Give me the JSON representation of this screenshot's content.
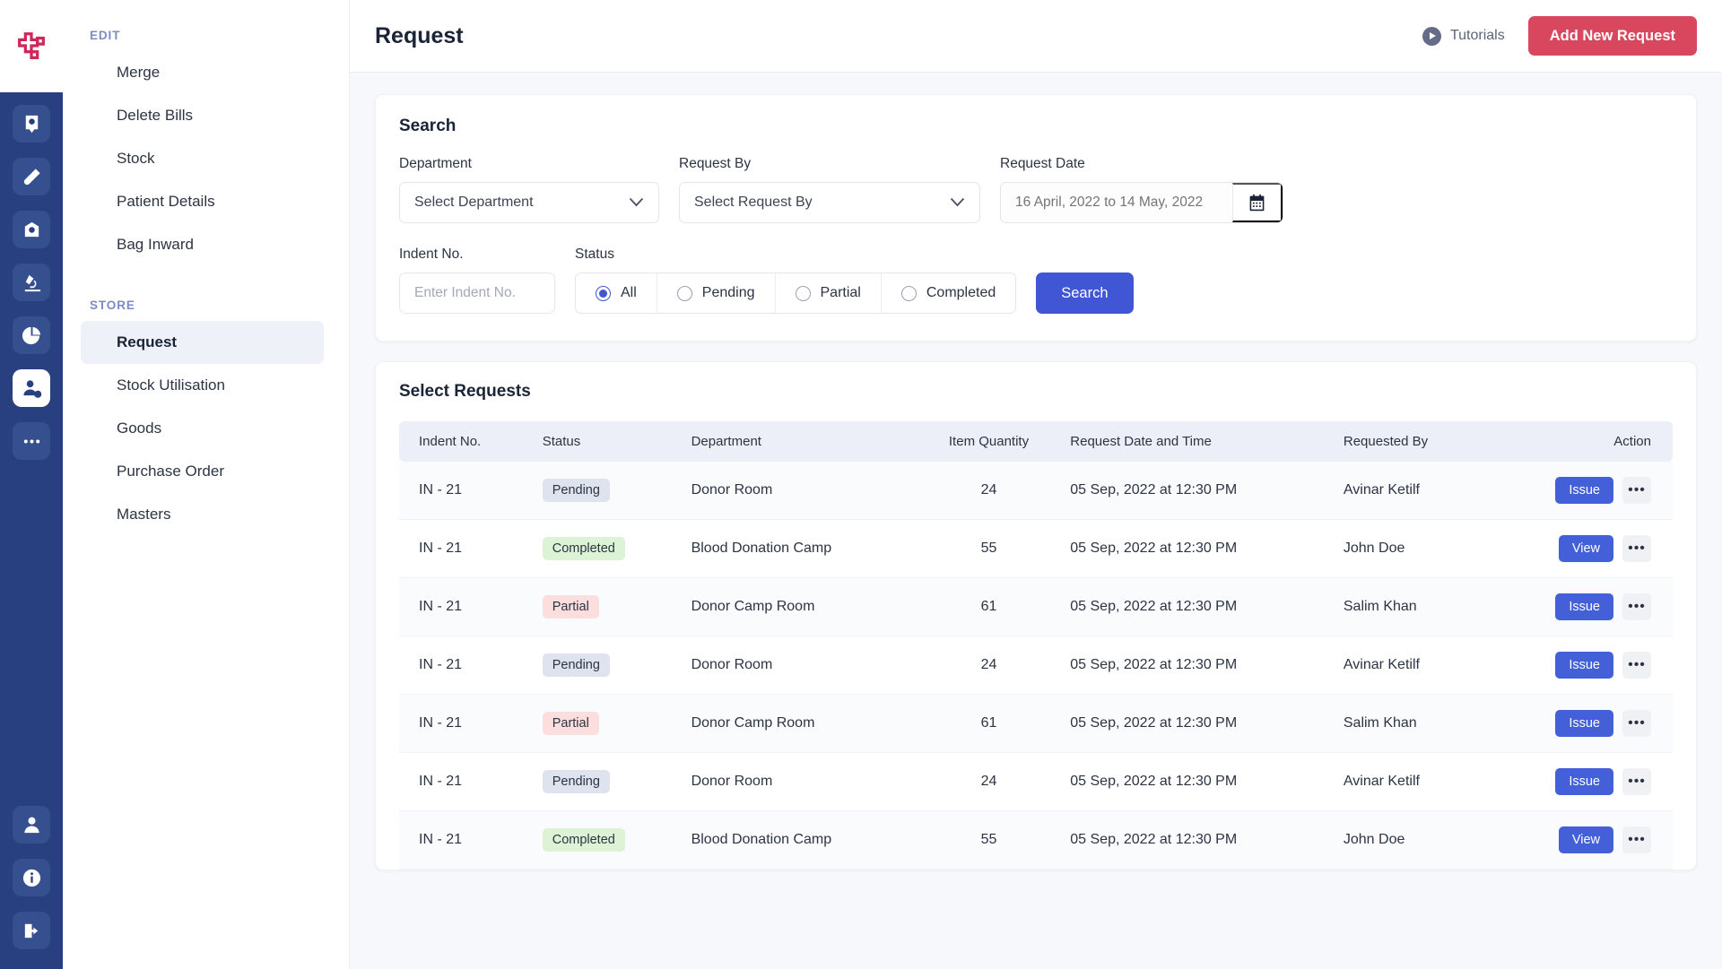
{
  "brand": {
    "logo_icon": "medical-cross-logo",
    "accent_red": "#d9475f",
    "accent_blue": "#4056d4",
    "rail_bg": "#28407f"
  },
  "rail": {
    "items": [
      {
        "icon": "blood-bag-icon",
        "active": false
      },
      {
        "icon": "test-tube-icon",
        "active": false
      },
      {
        "icon": "centrifuge-icon",
        "active": false
      },
      {
        "icon": "microscope-icon",
        "active": false
      },
      {
        "icon": "pie-chart-icon",
        "active": false
      },
      {
        "icon": "user-settings-icon",
        "active": true
      },
      {
        "icon": "more-dots-icon",
        "active": false
      }
    ],
    "bottom_items": [
      {
        "icon": "user-icon"
      },
      {
        "icon": "info-icon"
      },
      {
        "icon": "logout-icon"
      }
    ]
  },
  "sidebar": {
    "groups": [
      {
        "label": "EDIT",
        "items": [
          {
            "label": "Merge",
            "active": false
          },
          {
            "label": "Delete Bills",
            "active": false
          },
          {
            "label": "Stock",
            "active": false
          },
          {
            "label": "Patient Details",
            "active": false
          },
          {
            "label": "Bag Inward",
            "active": false
          }
        ]
      },
      {
        "label": "STORE",
        "items": [
          {
            "label": "Request",
            "active": true
          },
          {
            "label": "Stock Utilisation",
            "active": false
          },
          {
            "label": "Goods",
            "active": false
          },
          {
            "label": "Purchase Order",
            "active": false
          },
          {
            "label": "Masters",
            "active": false
          }
        ]
      }
    ]
  },
  "topbar": {
    "title": "Request",
    "tutorials_label": "Tutorials",
    "add_button_label": "Add New Request"
  },
  "search": {
    "title": "Search",
    "department": {
      "label": "Department",
      "value": "Select Department"
    },
    "request_by": {
      "label": "Request By",
      "value": "Select Request By"
    },
    "request_date": {
      "label": "Request Date",
      "placeholder": "16 April, 2022 to 14 May, 2022",
      "value": ""
    },
    "indent_no": {
      "label": "Indent No.",
      "placeholder": "Enter Indent No.",
      "value": ""
    },
    "status": {
      "label": "Status",
      "options": [
        {
          "label": "All",
          "selected": true
        },
        {
          "label": "Pending",
          "selected": false
        },
        {
          "label": "Partial",
          "selected": false
        },
        {
          "label": "Completed",
          "selected": false
        }
      ]
    },
    "search_button_label": "Search"
  },
  "table": {
    "title": "Select Requests",
    "columns": [
      "Indent No.",
      "Status",
      "Department",
      "Item Quantity",
      "Request Date and Time",
      "Requested By",
      "Action"
    ],
    "rows": [
      {
        "indent_no": "IN - 21",
        "status": "Pending",
        "status_kind": "pending",
        "department": "Donor Room",
        "quantity": "24",
        "datetime": "05 Sep, 2022 at 12:30 PM",
        "requested_by": "Avinar Ketilf",
        "action": "Issue"
      },
      {
        "indent_no": "IN - 21",
        "status": "Completed",
        "status_kind": "completed",
        "department": "Blood Donation Camp",
        "quantity": "55",
        "datetime": "05 Sep, 2022 at 12:30 PM",
        "requested_by": "John Doe",
        "action": "View"
      },
      {
        "indent_no": "IN - 21",
        "status": "Partial",
        "status_kind": "partial",
        "department": "Donor Camp Room",
        "quantity": "61",
        "datetime": "05 Sep, 2022 at 12:30 PM",
        "requested_by": "Salim Khan",
        "action": "Issue"
      },
      {
        "indent_no": "IN - 21",
        "status": "Pending",
        "status_kind": "pending",
        "department": "Donor Room",
        "quantity": "24",
        "datetime": "05 Sep, 2022 at 12:30 PM",
        "requested_by": "Avinar Ketilf",
        "action": "Issue"
      },
      {
        "indent_no": "IN - 21",
        "status": "Partial",
        "status_kind": "partial",
        "department": "Donor Camp Room",
        "quantity": "61",
        "datetime": "05 Sep, 2022 at 12:30 PM",
        "requested_by": "Salim Khan",
        "action": "Issue"
      },
      {
        "indent_no": "IN - 21",
        "status": "Pending",
        "status_kind": "pending",
        "department": "Donor Room",
        "quantity": "24",
        "datetime": "05 Sep, 2022 at 12:30 PM",
        "requested_by": "Avinar Ketilf",
        "action": "Issue"
      },
      {
        "indent_no": "IN - 21",
        "status": "Completed",
        "status_kind": "completed",
        "department": "Blood Donation Camp",
        "quantity": "55",
        "datetime": "05 Sep, 2022 at 12:30 PM",
        "requested_by": "John Doe",
        "action": "View"
      }
    ],
    "more_label": "•••"
  }
}
